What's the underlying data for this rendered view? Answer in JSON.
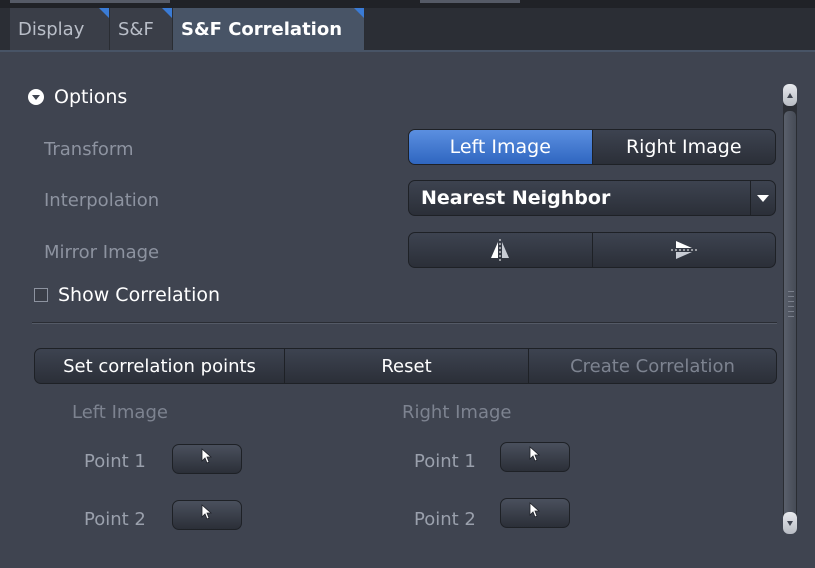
{
  "tabs": [
    {
      "label": "Display"
    },
    {
      "label": "S&F"
    },
    {
      "label": "S&F Correlation"
    }
  ],
  "options": {
    "header": "Options",
    "transform": {
      "label": "Transform",
      "buttons": [
        "Left Image",
        "Right Image"
      ],
      "selected": "Left Image"
    },
    "interpolation": {
      "label": "Interpolation",
      "value": "Nearest Neighbor"
    },
    "mirror": {
      "label": "Mirror Image",
      "buttons": [
        "mirror-horizontal-icon",
        "mirror-vertical-icon"
      ]
    },
    "show_correlation": {
      "label": "Show Correlation",
      "checked": false
    }
  },
  "actions": {
    "set_points": "Set correlation points",
    "reset": "Reset",
    "create": "Create Correlation"
  },
  "points": {
    "left_header": "Left Image",
    "right_header": "Right Image",
    "left": [
      {
        "label": "Point 1"
      },
      {
        "label": "Point 2"
      }
    ],
    "right": [
      {
        "label": "Point 1"
      },
      {
        "label": "Point 2"
      }
    ]
  },
  "colors": {
    "accent": "#3a7bd5",
    "panel_bg": "#3f4450",
    "disabled_text": "#7d8390"
  }
}
